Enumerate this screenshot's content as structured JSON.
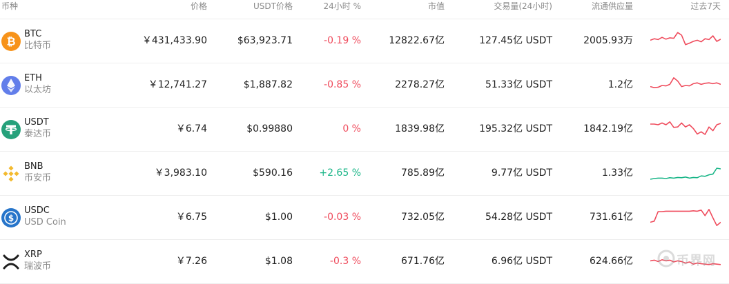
{
  "header": {
    "coin": "币种",
    "price": "价格",
    "usdt_price": "USDT价格",
    "change_24h": "24小时 %",
    "market_cap": "市值",
    "volume": "交易量(24小时)",
    "supply": "流通供应量",
    "last7d": "过去7天"
  },
  "rows": [
    {
      "symbol": "BTC",
      "name": "比特币",
      "icon": "bitcoin-icon",
      "price": "￥431,433.90",
      "usdt_price": "$63,923.71",
      "change": "-0.19 %",
      "market_cap": "12822.67亿",
      "volume": "127.45亿 USDT",
      "supply": "2005.93万",
      "trend": "down",
      "spark": [
        0.55,
        0.62,
        0.58,
        0.68,
        0.6,
        0.66,
        0.64,
        0.9,
        0.78,
        0.35,
        0.42,
        0.5,
        0.55,
        0.48,
        0.62,
        0.58,
        0.75,
        0.5,
        0.6
      ]
    },
    {
      "symbol": "ETH",
      "name": "以太坊",
      "icon": "ethereum-icon",
      "price": "￥12,741.27",
      "usdt_price": "$1,887.82",
      "change": "-0.85 %",
      "market_cap": "2278.27亿",
      "volume": "51.33亿 USDT",
      "supply": "1.2亿",
      "trend": "down",
      "spark": [
        0.45,
        0.4,
        0.42,
        0.5,
        0.48,
        0.55,
        0.85,
        0.7,
        0.45,
        0.5,
        0.48,
        0.58,
        0.62,
        0.55,
        0.6,
        0.62,
        0.58,
        0.62,
        0.55
      ]
    },
    {
      "symbol": "USDT",
      "name": "泰达币",
      "icon": "tether-icon",
      "price": "￥6.74",
      "usdt_price": "$0.99880",
      "change": "0 %",
      "market_cap": "1839.98亿",
      "volume": "195.32亿 USDT",
      "supply": "1842.19亿",
      "trend": "down",
      "spark": [
        0.75,
        0.75,
        0.72,
        0.8,
        0.72,
        0.85,
        0.6,
        0.62,
        0.8,
        0.62,
        0.72,
        0.55,
        0.3,
        0.4,
        0.28,
        0.62,
        0.45,
        0.72,
        0.78
      ]
    },
    {
      "symbol": "BNB",
      "name": "币安币",
      "icon": "bnb-icon",
      "price": "￥3,983.10",
      "usdt_price": "$590.16",
      "change": "+2.65 %",
      "market_cap": "785.89亿",
      "volume": "9.77亿 USDT",
      "supply": "1.33亿",
      "trend": "up",
      "spark": [
        0.25,
        0.28,
        0.3,
        0.3,
        0.28,
        0.32,
        0.3,
        0.33,
        0.32,
        0.35,
        0.3,
        0.33,
        0.32,
        0.4,
        0.38,
        0.45,
        0.48,
        0.75,
        0.72
      ]
    },
    {
      "symbol": "USDC",
      "name": "USD Coin",
      "icon": "usd-coin-icon",
      "price": "￥6.75",
      "usdt_price": "$1.00",
      "change": "-0.03 %",
      "market_cap": "732.05亿",
      "volume": "54.28亿 USDT",
      "supply": "731.61亿",
      "trend": "down",
      "spark": [
        0.3,
        0.35,
        0.78,
        0.78,
        0.8,
        0.8,
        0.8,
        0.8,
        0.8,
        0.8,
        0.8,
        0.82,
        0.8,
        0.85,
        0.6,
        0.88,
        0.5,
        0.15,
        0.3
      ]
    },
    {
      "symbol": "XRP",
      "name": "瑞波币",
      "icon": "xrp-icon",
      "price": "￥7.26",
      "usdt_price": "$1.08",
      "change": "-0.3 %",
      "market_cap": "671.76亿",
      "volume": "6.96亿 USDT",
      "supply": "624.66亿",
      "trend": "down",
      "spark": [
        0.55,
        0.58,
        0.52,
        0.6,
        0.55,
        0.58,
        0.5,
        0.55,
        0.52,
        0.45,
        0.5,
        0.4,
        0.45,
        0.42,
        0.4,
        0.38,
        0.42,
        0.4,
        0.38
      ]
    }
  ],
  "watermark": {
    "text": "币界网"
  },
  "colors": {
    "negative": "#ef4b5c",
    "positive": "#18b587",
    "btc": "#f7931a",
    "eth": "#627eea",
    "usdt": "#26a17b",
    "bnb": "#f3ba2f",
    "usdc": "#2775ca"
  }
}
